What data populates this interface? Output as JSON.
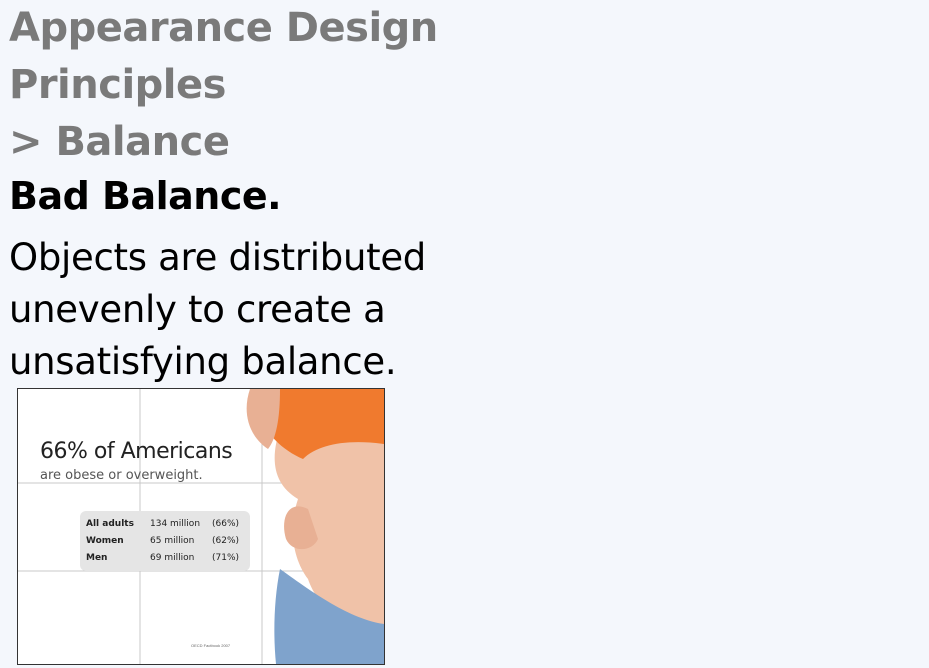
{
  "title_lines": [
    "Appearance Design",
    "Principles",
    "> Balance"
  ],
  "subhead": "Bad Balance.",
  "body_lines": [
    "Objects are distributed",
    "unevenly to create a",
    "unsatisfying balance."
  ],
  "image": {
    "heading_number": "66%",
    "heading_rest": " of Americans",
    "subheading": "are obese or overweight.",
    "rows": [
      {
        "label": "All adults",
        "count": "134 million",
        "pct": "(66%)"
      },
      {
        "label": "Women",
        "count": "65 million",
        "pct": "(62%)"
      },
      {
        "label": "Men",
        "count": "69 million",
        "pct": "(71%)"
      }
    ],
    "source": "OECD Factbook 2007",
    "colors": {
      "shirt": "#f07a2e",
      "jeans": "#7fa3cc",
      "skin": "#f0c2a8"
    }
  }
}
